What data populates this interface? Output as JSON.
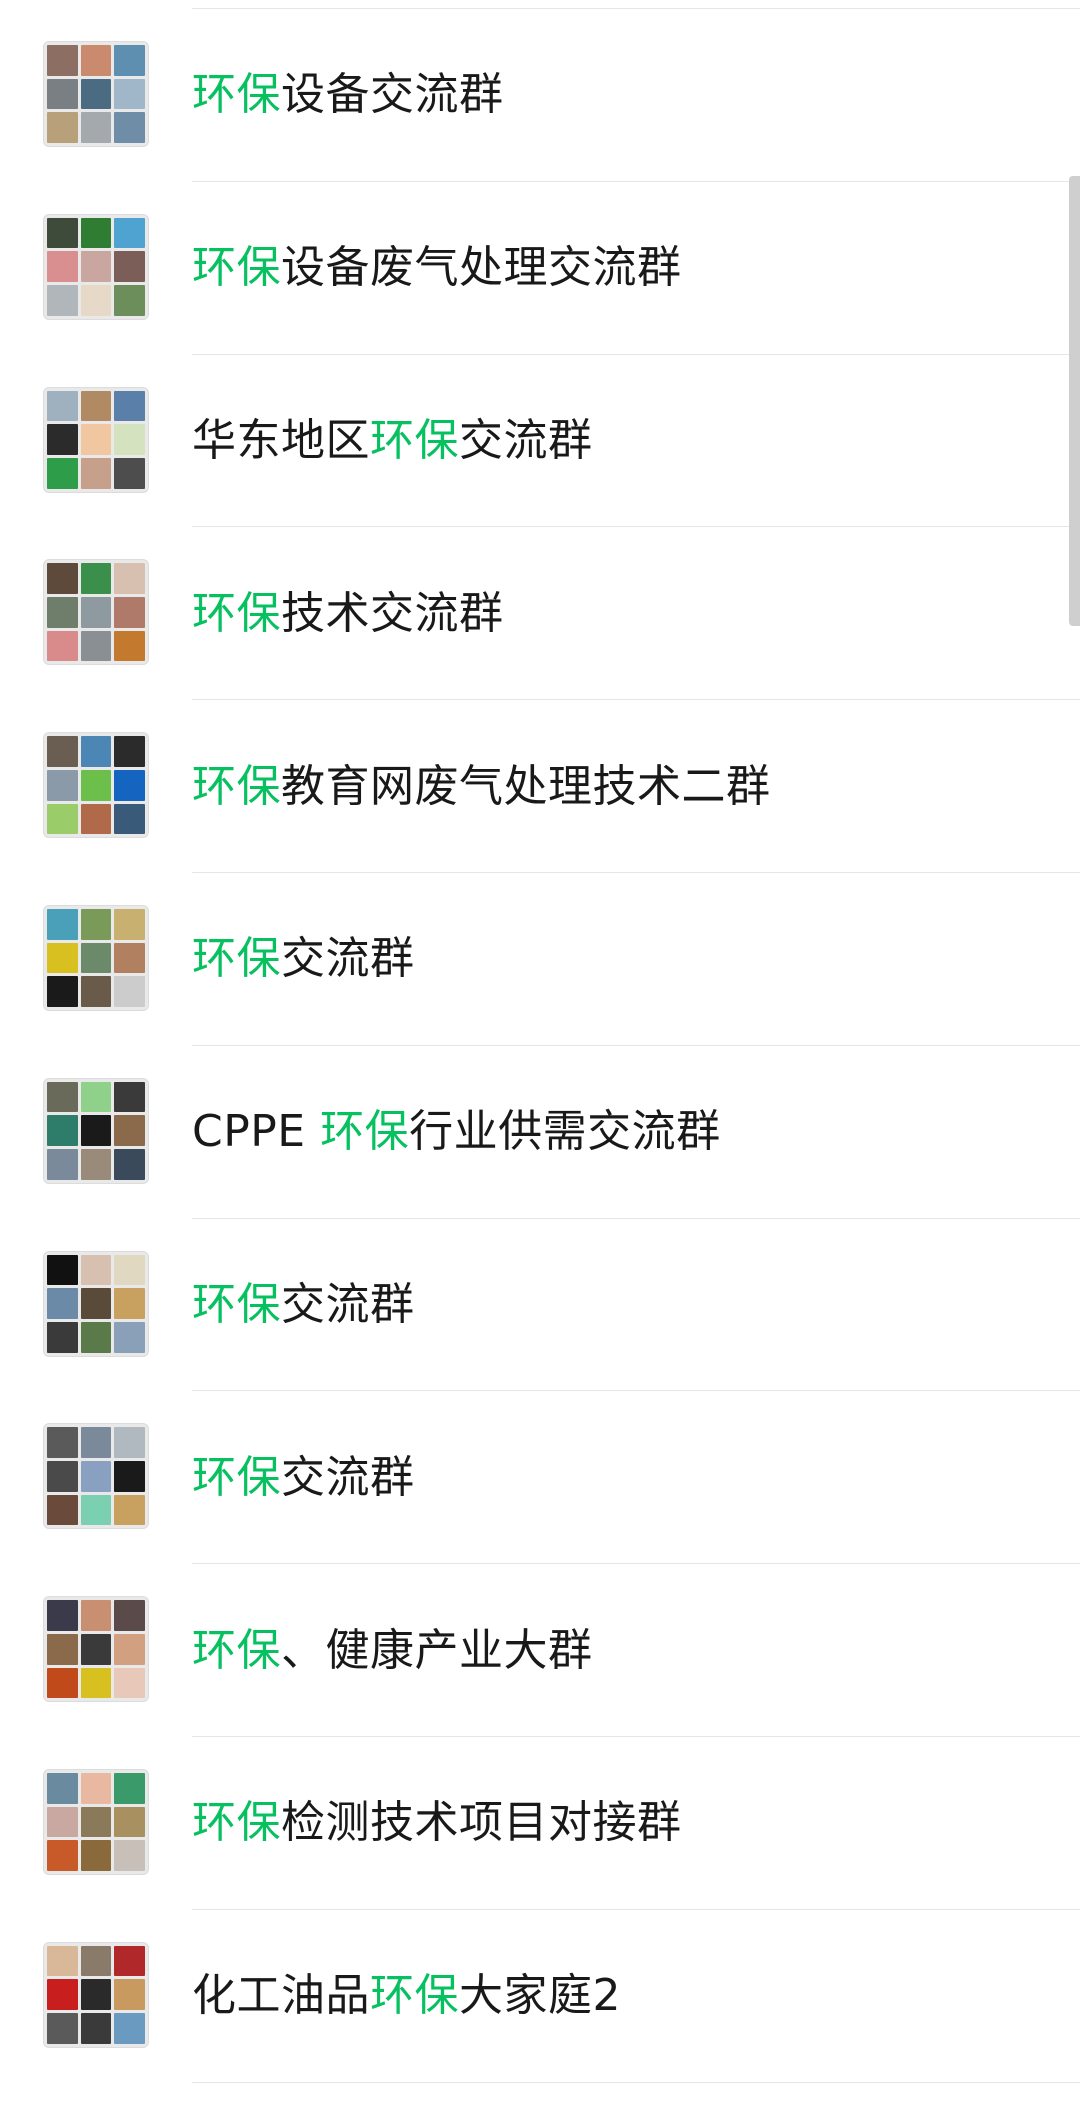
{
  "colors": {
    "highlight": "#07c160",
    "text": "#191919",
    "divider": "#e6e6e6",
    "scrollbar": "#cfcfcf"
  },
  "groups": [
    {
      "name": "环保设备交流群",
      "pre": "",
      "hl": "环保",
      "post": "设备交流群",
      "tiles": [
        "#8d6e63",
        "#c98a6d",
        "#5f8fb0",
        "#7a7f84",
        "#4a6b82",
        "#9fb7c9",
        "#b8a07a",
        "#a3a9ad",
        "#6f8da6"
      ]
    },
    {
      "name": "环保设备废气处理交流群",
      "pre": "",
      "hl": "环保",
      "post": "设备废气处理交流群",
      "tiles": [
        "#3e4a3a",
        "#2e7d32",
        "#4fa3d1",
        "#d98f8f",
        "#c9a7a0",
        "#7b5e57",
        "#b0b6ba",
        "#e7d9c7",
        "#6b8e5a"
      ]
    },
    {
      "name": "华东地区环保交流群",
      "pre": "华东地区",
      "hl": "环保",
      "post": "交流群",
      "tiles": [
        "#9fb0bf",
        "#b08a62",
        "#5a7fa8",
        "#2b2b2b",
        "#f0c7a0",
        "#d4e2c0",
        "#2e9d4a",
        "#c6a08a",
        "#4d4d4d"
      ]
    },
    {
      "name": "环保技术交流群",
      "pre": "",
      "hl": "环保",
      "post": "技术交流群",
      "tiles": [
        "#5d4a3a",
        "#3a8f4a",
        "#d8c0b0",
        "#6f7e6a",
        "#8e9aa0",
        "#b07a6a",
        "#d98a8a",
        "#8a8f94",
        "#c47a2e"
      ]
    },
    {
      "name": "环保教育网废气处理技术二群",
      "pre": "",
      "hl": "环保",
      "post": "教育网废气处理技术二群",
      "tiles": [
        "#6a5e52",
        "#4b86b4",
        "#2b2b2b",
        "#8a9aa8",
        "#6bbf4a",
        "#1565c0",
        "#9acd6a",
        "#b06a4a",
        "#3a5a7a"
      ]
    },
    {
      "name": "环保交流群",
      "pre": "",
      "hl": "环保",
      "post": "交流群",
      "tiles": [
        "#4aa0b8",
        "#7a9a5a",
        "#c8b070",
        "#d8c020",
        "#6a8a6a",
        "#b08060",
        "#1a1a1a",
        "#6a5a4a",
        "#cccccc"
      ]
    },
    {
      "name": "CPPE 环保行业供需交流群",
      "pre": "CPPE ",
      "hl": "环保",
      "post": "行业供需交流群",
      "tiles": [
        "#6a6a5a",
        "#8fd18a",
        "#3a3a3a",
        "#2e7d6a",
        "#1a1a1a",
        "#8a6a4a",
        "#7a8a9a",
        "#9a8a7a",
        "#3a4a5a"
      ]
    },
    {
      "name": "环保交流群",
      "pre": "",
      "hl": "环保",
      "post": "交流群",
      "tiles": [
        "#111111",
        "#d8c0b0",
        "#e0d8c0",
        "#6a8aa8",
        "#5a4a3a",
        "#c8a060",
        "#3a3a3a",
        "#5a7a4a",
        "#8aa0b8"
      ]
    },
    {
      "name": "环保交流群",
      "pre": "",
      "hl": "环保",
      "post": "交流群",
      "tiles": [
        "#5a5a5a",
        "#7a8a9a",
        "#b0b8c0",
        "#4a4a4a",
        "#8aa0c0",
        "#1a1a1a",
        "#6a4a3a",
        "#7ad0b0",
        "#c8a060"
      ]
    },
    {
      "name": "环保、健康产业大群",
      "pre": "",
      "hl": "环保",
      "post": "、健康产业大群",
      "tiles": [
        "#3a3a4a",
        "#c89070",
        "#5a4a4a",
        "#8a6a4a",
        "#3a3a3a",
        "#d0a080",
        "#c04a1a",
        "#d8c020",
        "#e8c8b8"
      ]
    },
    {
      "name": "环保检测技术项目对接群",
      "pre": "",
      "hl": "环保",
      "post": "检测技术项目对接群",
      "tiles": [
        "#6a8aa0",
        "#e8b8a0",
        "#3a9a6a",
        "#c8a8a0",
        "#8a7a5a",
        "#a89060",
        "#c85a2a",
        "#8a6a3a",
        "#c8c0b8"
      ]
    },
    {
      "name": "化工油品环保大家庭2",
      "pre": "化工油品",
      "hl": "环保",
      "post": "大家庭2",
      "tiles": [
        "#d8b898",
        "#8a7a6a",
        "#b0282a",
        "#c81e1e",
        "#2a2a2a",
        "#c89a60",
        "#5a5a5a",
        "#3a3a3a",
        "#6a9ac0"
      ]
    }
  ]
}
